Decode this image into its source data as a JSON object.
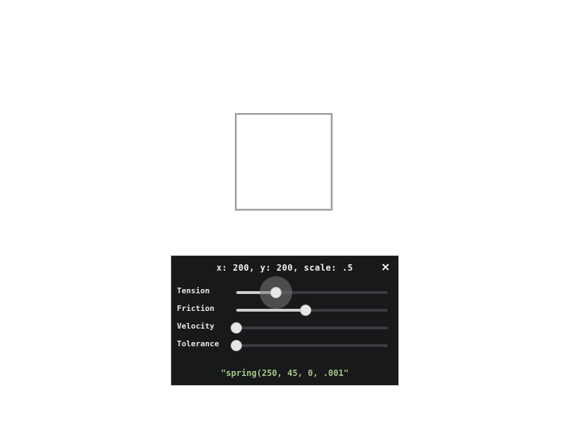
{
  "panel": {
    "header": "x: 200, y: 200, scale: .5",
    "close_icon": "×",
    "sliders": [
      {
        "label": "Tension",
        "value_fraction": 0.26
      },
      {
        "label": "Friction",
        "value_fraction": 0.46
      },
      {
        "label": "Velocity",
        "value_fraction": 0.0
      },
      {
        "label": "Tolerance",
        "value_fraction": 0.0
      }
    ],
    "output": "\"spring(250, 45, 0, .001\""
  },
  "colors": {
    "panel_bg": "#18191b",
    "output_text": "#a7c58a",
    "box_border": "#9a9a9a"
  }
}
